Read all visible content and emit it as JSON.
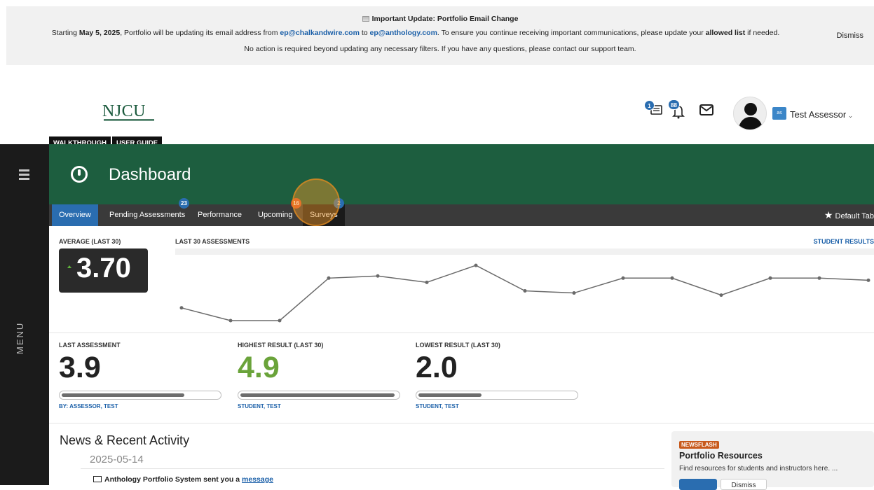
{
  "banner": {
    "title": "Important Update: Portfolio Email Change",
    "line1_pre": "Starting ",
    "line1_date": "May 5, 2025",
    "line1_mid": ", Portfolio will be updating its email address from ",
    "old_email": "ep@chalkandwire.com",
    "line1_to": " to ",
    "new_email": "ep@anthology.com",
    "line1_post": ". To ensure you continue receiving important communications, please update your ",
    "allowed_list": "allowed list",
    "line1_end": " if needed.",
    "line2": "No action is required beyond updating any necessary filters. If you have any questions, please contact our support team.",
    "dismiss_label": "Dismiss"
  },
  "header": {
    "logo_text": "NJCU",
    "notifications": {
      "assignments_count": "1",
      "alerts_count": "88"
    },
    "user_chip": "as",
    "user_name": "Test Assessor",
    "guide_tabs": [
      "WALKTHROUGH",
      "USER GUIDE"
    ]
  },
  "left_menu": {
    "label": "MENU"
  },
  "dashboard": {
    "title": "Dashboard"
  },
  "tabs": {
    "overview": "Overview",
    "pending": "Pending Assessments",
    "pending_count": "23",
    "performance": "Performance",
    "upcoming": "Upcoming",
    "upcoming_count": "16",
    "surveys": "Surveys",
    "surveys_count": "2",
    "default_tab": "Default Tab"
  },
  "stats": {
    "average_label": "AVERAGE (LAST 30)",
    "average_value": "3.70",
    "last30_label": "LAST 30 ASSESSMENTS",
    "student_results": "STUDENT RESULTS",
    "last_assessment": {
      "label": "LAST ASSESSMENT",
      "value": "3.9",
      "by_prefix": "BY: ",
      "by_name": "ASSESSOR, TEST",
      "fill": 0.78
    },
    "highest": {
      "label": "HIGHEST RESULT (LAST 30)",
      "value": "4.9",
      "name": "STUDENT, TEST",
      "fill": 0.98
    },
    "lowest": {
      "label": "LOWEST RESULT (LAST 30)",
      "value": "2.0",
      "name": "STUDENT, TEST",
      "fill": 0.4
    }
  },
  "chart_data": {
    "type": "line",
    "title": "LAST 30 ASSESSMENTS",
    "values": [
      2.6,
      2.0,
      2.0,
      4.0,
      4.1,
      3.8,
      4.6,
      3.4,
      3.3,
      4.0,
      4.0,
      3.2,
      4.0,
      4.0,
      3.9
    ],
    "ylim": [
      2.0,
      4.9
    ],
    "grid": false,
    "colors": {
      "line": "#6a6a6a",
      "points": "#6a6a6a"
    }
  },
  "news": {
    "title": "News & Recent Activity",
    "date": "2025-05-14",
    "item_prefix": "Anthology Portfolio System sent you a ",
    "item_link": "message"
  },
  "newsflash": {
    "tag": "NEWSFLASH",
    "title": "Portfolio Resources",
    "description": "Find resources for students and instructors here. ...",
    "dismiss_label": "Dismiss"
  },
  "colors": {
    "brand_green": "#1d5e3f",
    "tab_active": "#2a6db0",
    "badge_blue": "#2a6db0",
    "badge_orange": "#e0542a",
    "highest_value": "#6aa33a",
    "newsflash_tag": "#c85a1c"
  }
}
